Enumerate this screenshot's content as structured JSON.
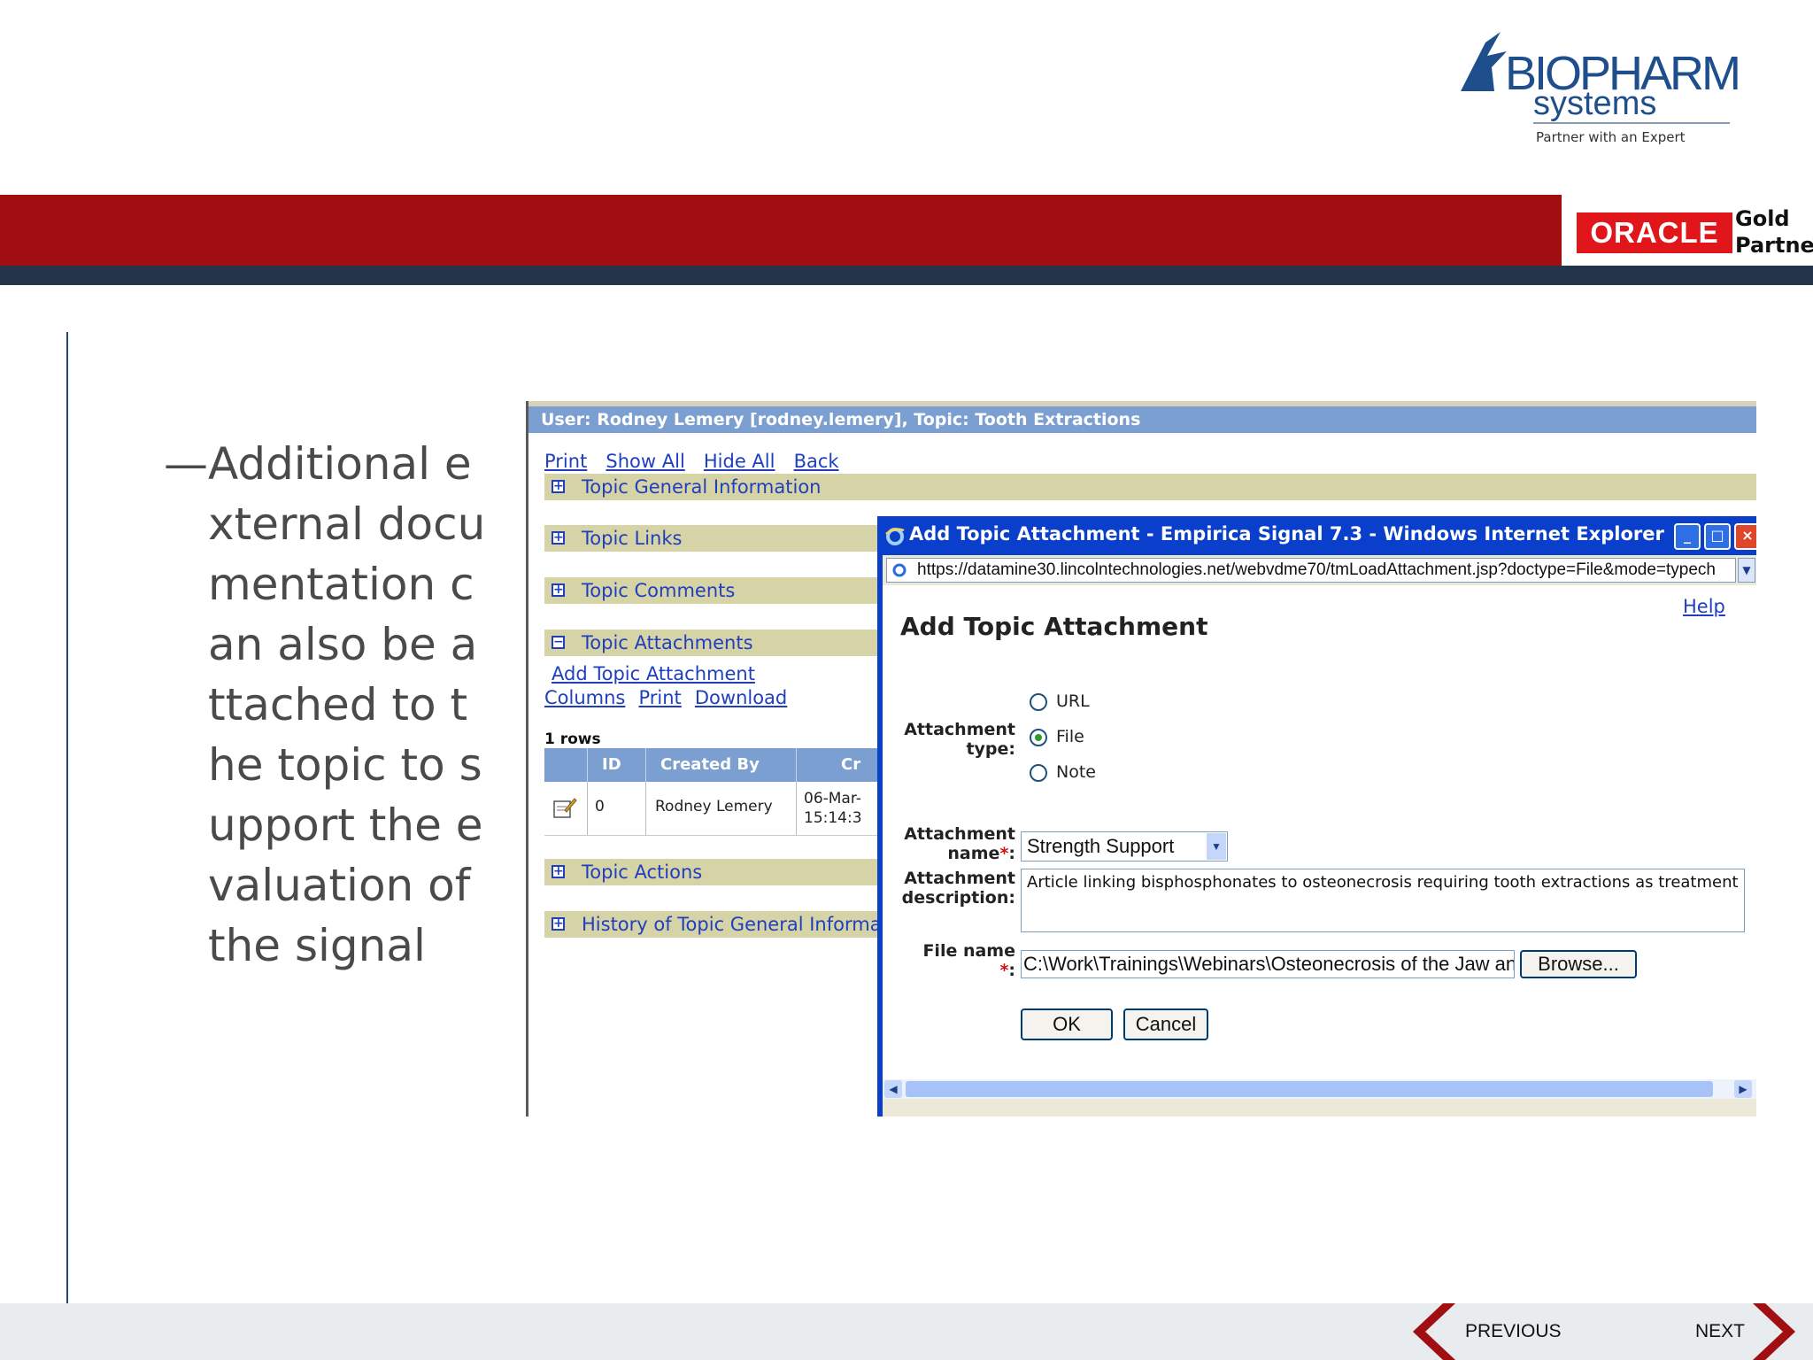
{
  "brand": {
    "logo_main": "BIOPHARM",
    "logo_sub": "systems",
    "tagline": "Partner with an Expert",
    "partner_logo": "ORACLE",
    "partner_level_1": "Gold",
    "partner_level_2": "Partner",
    "colors": {
      "red_band": "#a00e12",
      "navy_band": "#24344a",
      "oracle_red": "#e0161b",
      "logo_blue": "#1f4e8c"
    }
  },
  "bullet": {
    "dash": "—",
    "text": "Additional external documentation can also be attached to the topic to support the evaluation of the signal"
  },
  "app": {
    "user_bar": "User: Rodney Lemery [rodney.lemery],  Topic: Tooth Extractions",
    "top_links": [
      "Print",
      "Show All",
      "Hide All",
      "Back"
    ],
    "sections": {
      "general": {
        "label": "Topic General Information",
        "icon": "plus-box-icon"
      },
      "links": {
        "label": "Topic Links",
        "icon": "plus-box-icon"
      },
      "comments": {
        "label": "Topic Comments",
        "icon": "plus-box-icon"
      },
      "attachments": {
        "label": "Topic Attachments",
        "icon": "minus-box-icon"
      },
      "actions": {
        "label": "Topic Actions",
        "icon": "plus-box-icon"
      },
      "history": {
        "label": "History of Topic General Information",
        "icon": "plus-box-icon"
      }
    },
    "attachment_links": {
      "add": "Add Topic Attachment",
      "columns": "Columns",
      "print": "Print",
      "download": "Download"
    },
    "rows_count": "1 rows",
    "grid": {
      "headers": [
        "ID",
        "Created By",
        "Cr"
      ],
      "row": {
        "id": "0",
        "created_by": "Rodney Lemery",
        "date": "06-Mar-",
        "time": "15:14:3",
        "icon": "edit-note-icon"
      }
    }
  },
  "dialog": {
    "window_title": "Add Topic Attachment - Empirica Signal 7.3 - Windows Internet Explorer",
    "address": "https://datamine30.lincolntechnologies.net/webvdme70/tmLoadAttachment.jsp?doctype=File&mode=typech",
    "help": "Help",
    "heading": "Add Topic Attachment",
    "type_label": "Attachment type:",
    "type_options": [
      "URL",
      "File",
      "Note"
    ],
    "selected_type": "File",
    "name_label": "Attachment name",
    "name_value": "Strength Support",
    "description_label": "Attachment description:",
    "description_value": "Article linking bisphosphonates to osteonecrosis requiring tooth extractions as treatment",
    "file_label": "File name",
    "required_mark": "*",
    "colon": ":",
    "file_value": "C:\\Work\\Trainings\\Webinars\\Osteonecrosis of the Jaw an",
    "browse_button": "Browse...",
    "ok_button": "OK",
    "cancel_button": "Cancel"
  },
  "footer": {
    "previous": "PREVIOUS",
    "next": "NEXT",
    "arrow_color": "#a00e12"
  }
}
